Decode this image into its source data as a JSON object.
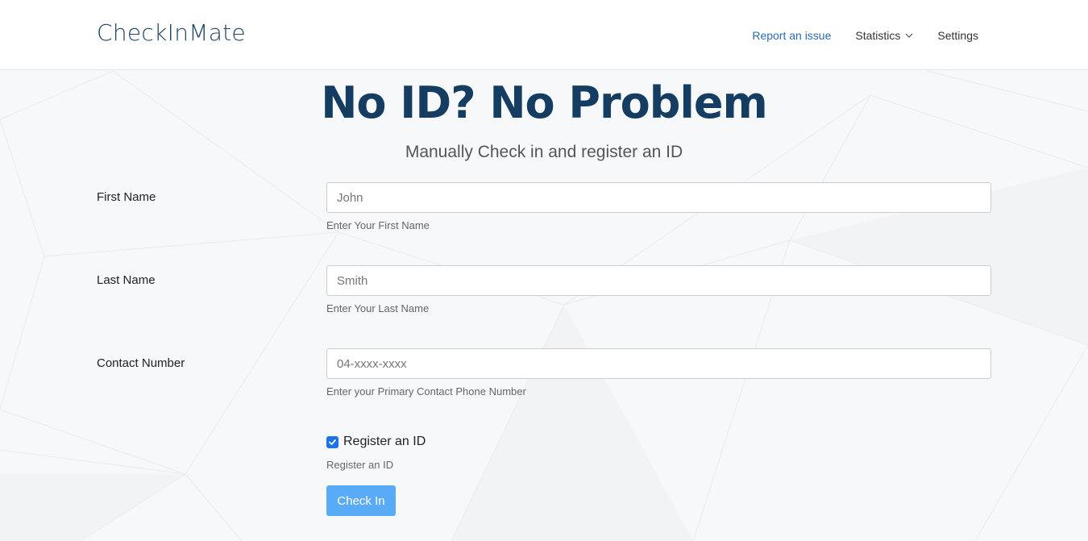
{
  "nav": {
    "brand": "CheckInMate",
    "links": [
      {
        "label": "Report an issue"
      },
      {
        "label": "Statistics"
      },
      {
        "label": "Settings"
      }
    ]
  },
  "hero": {
    "title": "No ID? No Problem",
    "subtitle": "Manually Check in and register an ID"
  },
  "form": {
    "first_name": {
      "label": "First Name",
      "placeholder": "John",
      "help": "Enter Your First Name"
    },
    "last_name": {
      "label": "Last Name",
      "placeholder": "Smith",
      "help": "Enter Your Last Name"
    },
    "contact": {
      "label": "Contact Number",
      "placeholder": "04-xxxx-xxxx",
      "help": "Enter your Primary Contact Phone Number"
    },
    "register": {
      "label": "Register an ID",
      "checked": true,
      "help": "Register an ID"
    },
    "submit_label": "Check In"
  },
  "colors": {
    "brand": "#1e4466",
    "hero": "#143d61",
    "link_accent": "#2b6cb0",
    "button": "#5aabf7",
    "checkbox": "#1a73e8"
  },
  "icons": {
    "statistics_dropdown": "chevron-down-icon",
    "register_checkbox": "checkmark-icon"
  }
}
